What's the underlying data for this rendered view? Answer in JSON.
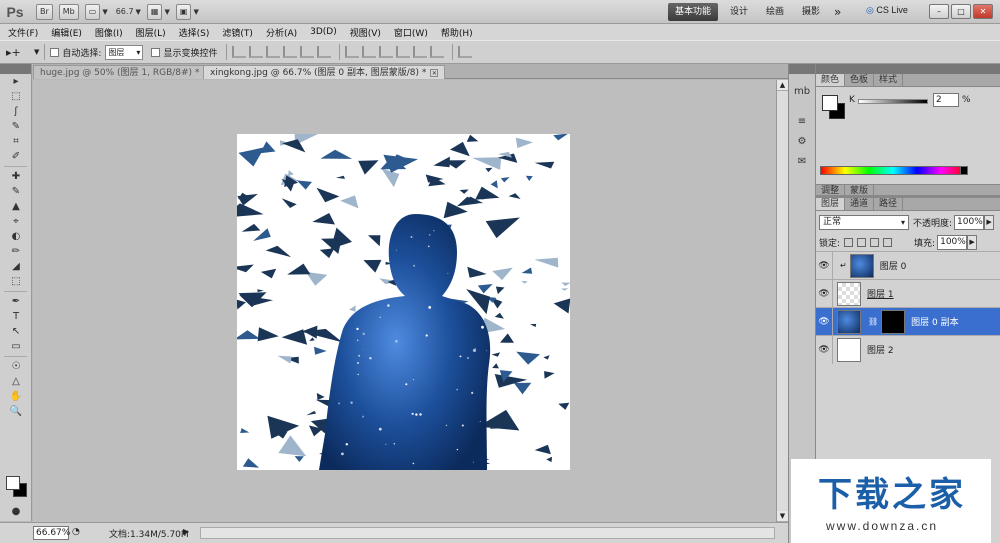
{
  "app": {
    "logo": "Ps",
    "toolbar_buttons": [
      "Br",
      "Mb"
    ],
    "zoom_value": "66.7",
    "workspace_active": "基本功能",
    "workspaces": [
      "设计",
      "绘画",
      "摄影"
    ],
    "more": "»",
    "cs_live": "CS Live",
    "window_controls": [
      "–",
      "□",
      "✕"
    ]
  },
  "menu": [
    "文件(F)",
    "编辑(E)",
    "图像(I)",
    "图层(L)",
    "选择(S)",
    "滤镜(T)",
    "分析(A)",
    "3D(D)",
    "视图(V)",
    "窗口(W)",
    "帮助(H)"
  ],
  "options": {
    "tool_glyph": "▸+",
    "auto_select_label": "自动选择:",
    "auto_select_value": "图层",
    "show_transform_label": "显示变换控件"
  },
  "tabs": [
    {
      "label": "huge.jpg @ 50% (图层 1, RGB/8#) *",
      "active": false
    },
    {
      "label": "xingkong.jpg @ 66.7% (图层 0 副本, 图层蒙版/8) *",
      "active": true
    }
  ],
  "tools": [
    "▸",
    "⬚",
    "ʃ",
    "✎",
    "⌗",
    "✐",
    "✚",
    "✎",
    "▲",
    "⌖",
    "◐",
    "✏",
    "◢",
    "⬚",
    "△",
    "●",
    "✒",
    "T",
    "↖",
    "▭",
    "☉",
    "✋",
    "🔍"
  ],
  "status": {
    "zoom": "66.67%",
    "doc_info": "文档:1.34M/5.70M",
    "arrow": "▶"
  },
  "right_strip_icons": [
    "mb",
    "≡",
    "⚙",
    "✉"
  ],
  "color_panel": {
    "tabs": [
      "颜色",
      "色板",
      "样式"
    ],
    "channel": "K",
    "value": "2",
    "unit": "%"
  },
  "adjust_tabs": [
    "调整",
    "蒙版"
  ],
  "layers_panel": {
    "tabs": [
      "图层",
      "通道",
      "路径"
    ],
    "blend_mode": "正常",
    "opacity_label": "不透明度:",
    "opacity": "100%",
    "lock_label": "锁定:",
    "fill_label": "填充:",
    "fill": "100%",
    "layers": [
      {
        "name": "图层 0",
        "thumb": "space",
        "selected": false,
        "underline": false
      },
      {
        "name": "图层 1",
        "thumb": "check",
        "selected": false,
        "underline": true
      },
      {
        "name": "图层 0 副本",
        "thumb": "space",
        "selected": true,
        "underline": false,
        "mask": true
      },
      {
        "name": "图层 2",
        "thumb": "white",
        "selected": false,
        "underline": false
      }
    ]
  },
  "watermark": {
    "title": "下载之家",
    "url": "www.downza.cn"
  },
  "colors": {
    "selection_blue": "#3a6fcf",
    "watermark_blue": "#1a5fa8",
    "space_dark": "#0c2b5d",
    "space_light": "#4f8be0"
  }
}
